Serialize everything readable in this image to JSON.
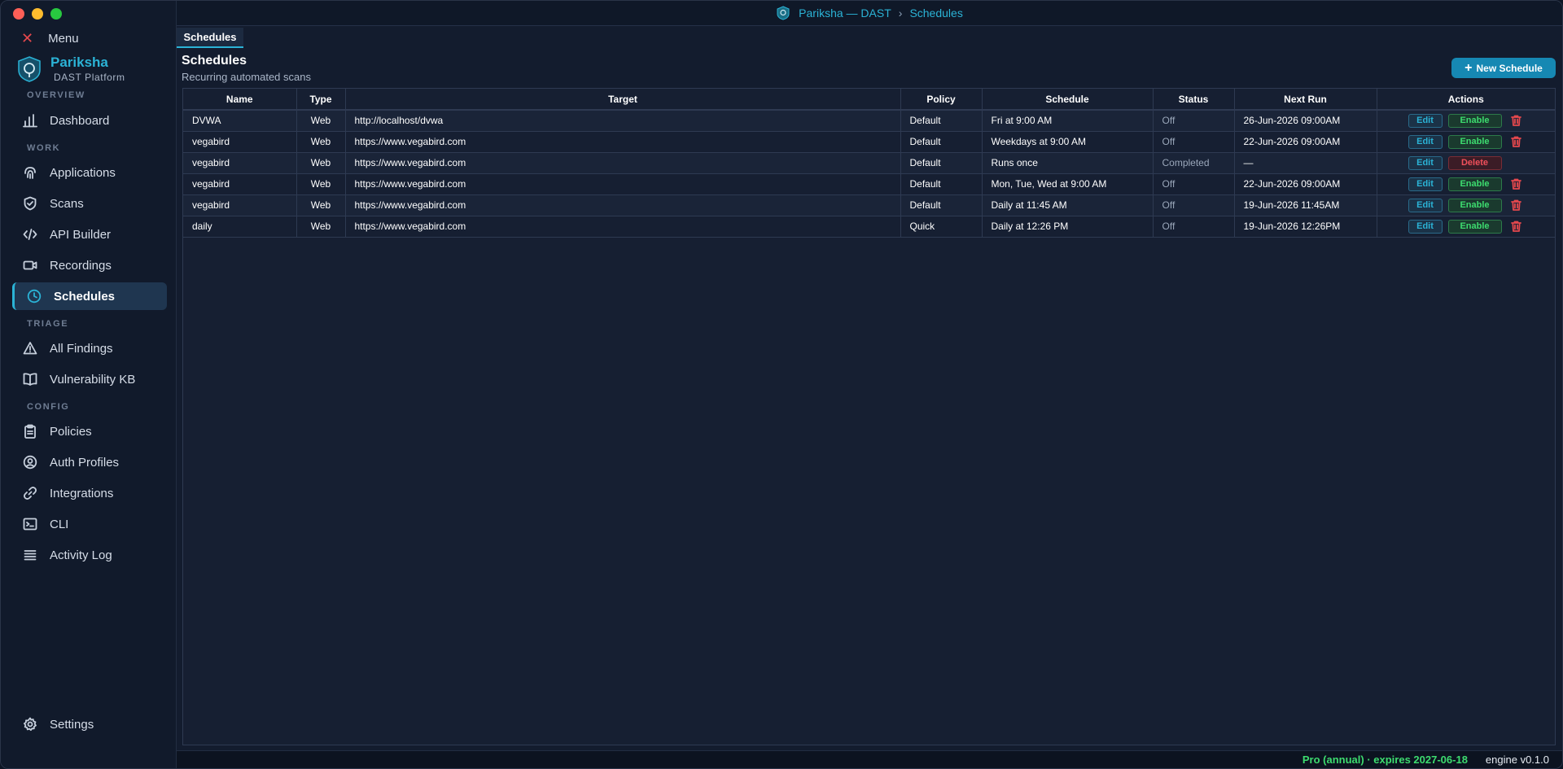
{
  "window": {
    "title_app": "Pariksha — DAST",
    "title_page": "Schedules"
  },
  "sidebar": {
    "menu_label": "Menu",
    "brand_name": "Pariksha",
    "brand_sub": "DAST Platform",
    "sections": {
      "overview": "OVERVIEW",
      "work": "WORK",
      "triage": "TRIAGE",
      "config": "CONFIG"
    },
    "items": {
      "dashboard": "Dashboard",
      "applications": "Applications",
      "scans": "Scans",
      "api_builder": "API Builder",
      "recordings": "Recordings",
      "schedules": "Schedules",
      "all_findings": "All Findings",
      "vulnerability_kb": "Vulnerability KB",
      "policies": "Policies",
      "auth_profiles": "Auth Profiles",
      "integrations": "Integrations",
      "cli": "CLI",
      "activity_log": "Activity Log",
      "settings": "Settings"
    }
  },
  "tabs": [
    "Schedules"
  ],
  "page": {
    "title": "Schedules",
    "subtitle": "Recurring automated scans",
    "new_button": "New Schedule"
  },
  "table": {
    "headers": {
      "name": "Name",
      "type": "Type",
      "target": "Target",
      "policy": "Policy",
      "schedule": "Schedule",
      "status": "Status",
      "next_run": "Next Run",
      "actions": "Actions"
    },
    "rows": [
      {
        "name": "DVWA",
        "type": "Web",
        "target": "http://localhost/dvwa",
        "policy": "Default",
        "schedule": "Fri at 9:00 AM",
        "status": "Off",
        "next_run": "26-Jun-2026 09:00AM",
        "edit": "Edit",
        "toggle": "Enable"
      },
      {
        "name": "vegabird",
        "type": "Web",
        "target": "https://www.vegabird.com",
        "policy": "Default",
        "schedule": "Weekdays at 9:00 AM",
        "status": "Off",
        "next_run": "22-Jun-2026 09:00AM",
        "edit": "Edit",
        "toggle": "Enable"
      },
      {
        "name": "vegabird",
        "type": "Web",
        "target": "https://www.vegabird.com",
        "policy": "Default",
        "schedule": "Runs once",
        "status": "Completed",
        "next_run": "—",
        "edit": "Edit",
        "delete": "Delete"
      },
      {
        "name": "vegabird",
        "type": "Web",
        "target": "https://www.vegabird.com",
        "policy": "Default",
        "schedule": "Mon, Tue, Wed at 9:00 AM",
        "status": "Off",
        "next_run": "22-Jun-2026 09:00AM",
        "edit": "Edit",
        "toggle": "Enable"
      },
      {
        "name": "vegabird",
        "type": "Web",
        "target": "https://www.vegabird.com",
        "policy": "Default",
        "schedule": "Daily at 11:45 AM",
        "status": "Off",
        "next_run": "19-Jun-2026 11:45AM",
        "edit": "Edit",
        "toggle": "Enable"
      },
      {
        "name": "daily",
        "type": "Web",
        "target": "https://www.vegabird.com",
        "policy": "Quick",
        "schedule": "Daily at 12:26 PM",
        "status": "Off",
        "next_run": "19-Jun-2026 12:26PM",
        "edit": "Edit",
        "toggle": "Enable"
      }
    ]
  },
  "statusbar": {
    "license": "Pro (annual) · expires 2027-06-18",
    "engine": "engine v0.1.0"
  },
  "colors": {
    "accent": "#2bb3d6",
    "enable": "#3ddc6f",
    "danger": "#e5484d",
    "background": "#131c2e"
  }
}
